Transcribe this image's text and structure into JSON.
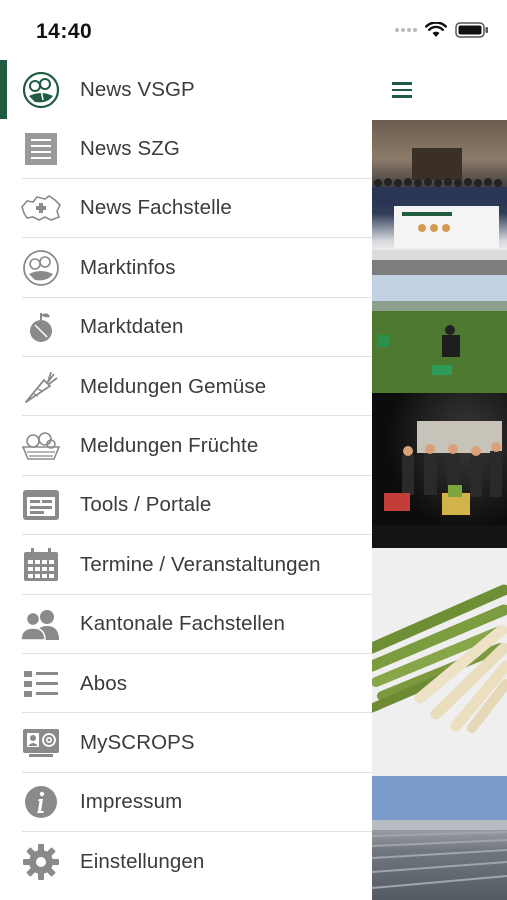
{
  "status_bar": {
    "time": "14:40"
  },
  "menu": {
    "items": [
      {
        "label": "News VSGP",
        "icon": "vsgp-logo-icon",
        "active": true
      },
      {
        "label": "News SZG",
        "icon": "szg-logo-icon"
      },
      {
        "label": "News Fachstelle",
        "icon": "swiss-map-icon"
      },
      {
        "label": "Marktinfos",
        "icon": "vegetables-icon"
      },
      {
        "label": "Marktdaten",
        "icon": "fruit-icon"
      },
      {
        "label": "Meldungen Gemüse",
        "icon": "carrot-icon"
      },
      {
        "label": "Meldungen Früchte",
        "icon": "fruit-basket-icon"
      },
      {
        "label": "Tools / Portale",
        "icon": "tools-window-icon"
      },
      {
        "label": "Termine / Veranstaltungen",
        "icon": "calendar-icon"
      },
      {
        "label": "Kantonale Fachstellen",
        "icon": "people-icon"
      },
      {
        "label": "Abos",
        "icon": "list-icon"
      },
      {
        "label": "MySCROPS",
        "icon": "contact-card-icon"
      },
      {
        "label": "Impressum",
        "icon": "info-icon"
      },
      {
        "label": "Einstellungen",
        "icon": "gear-icon"
      }
    ]
  },
  "colors": {
    "accent": "#1f5c41",
    "text": "#3b3b3b",
    "icon": "#8a8a8a"
  }
}
